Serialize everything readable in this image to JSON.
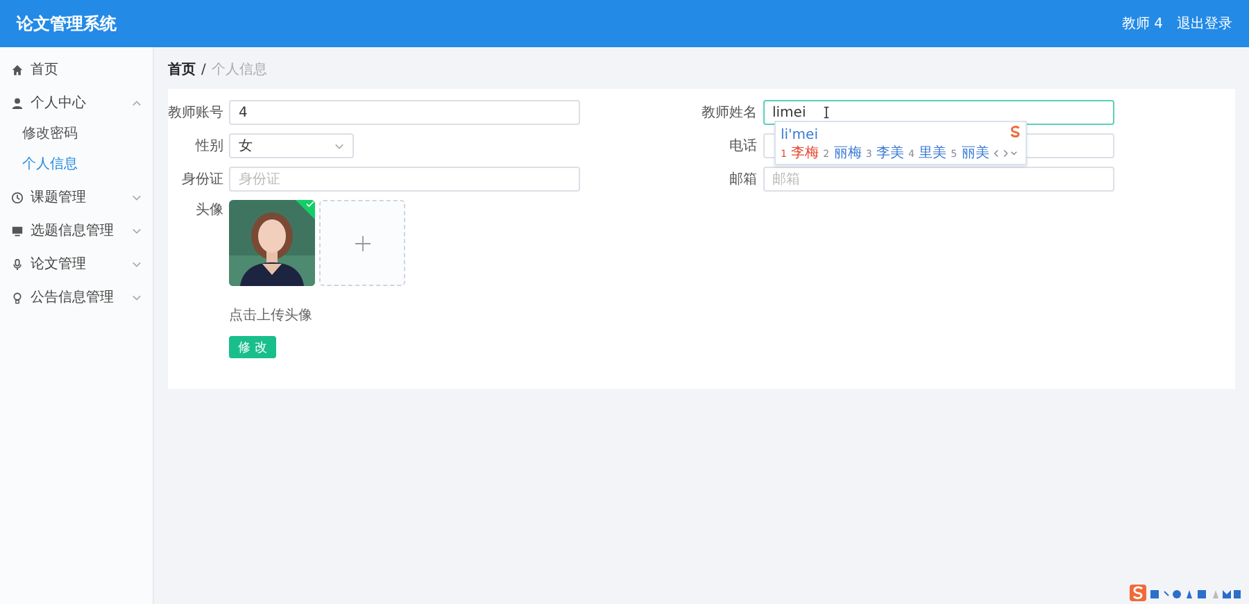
{
  "header": {
    "title": "论文管理系统",
    "user": "教师 4",
    "logout": "退出登录"
  },
  "sidebar": {
    "items": [
      {
        "label": "首页",
        "selected": false
      },
      {
        "label": "个人中心",
        "expanded": true,
        "selected": false,
        "children": [
          {
            "label": "修改密码",
            "selected": false
          },
          {
            "label": "个人信息",
            "selected": true
          }
        ]
      },
      {
        "label": "课题管理",
        "expanded": false,
        "selected": false
      },
      {
        "label": "选题信息管理",
        "expanded": false,
        "selected": false
      },
      {
        "label": "论文管理",
        "expanded": false,
        "selected": false
      },
      {
        "label": "公告信息管理",
        "expanded": false,
        "selected": false
      }
    ]
  },
  "breadcrumb": {
    "separator": "/",
    "items": [
      {
        "label": "首页",
        "selected": false
      },
      {
        "label": "个人信息",
        "selected": true
      }
    ]
  },
  "form": {
    "fields": [
      {
        "label": "教师账号",
        "kind": "input",
        "value": "4",
        "focused": false
      },
      {
        "label": "教师姓名",
        "kind": "input",
        "value": "limei",
        "focused": true
      },
      {
        "label": "性别",
        "kind": "select",
        "value": "女",
        "focused": false
      },
      {
        "label": "电话",
        "kind": "input",
        "focused": false
      },
      {
        "label": "身份证",
        "kind": "input",
        "placeholder": "身份证",
        "focused": false
      },
      {
        "label": "邮箱",
        "kind": "input",
        "placeholder": "邮箱",
        "focused": false
      }
    ],
    "avatar": {
      "label": "头像",
      "uploaded": true,
      "hint": "点击上传头像"
    },
    "submit": "修 改"
  },
  "ime": {
    "pinyin": "li'mei",
    "candidates": [
      {
        "number": "1",
        "text": "李梅",
        "selected": true
      },
      {
        "number": "2",
        "text": "丽梅",
        "selected": false
      },
      {
        "number": "3",
        "text": "李美",
        "selected": false
      },
      {
        "number": "4",
        "text": "里美",
        "selected": false
      },
      {
        "number": "5",
        "text": "丽美",
        "selected": false
      }
    ]
  }
}
